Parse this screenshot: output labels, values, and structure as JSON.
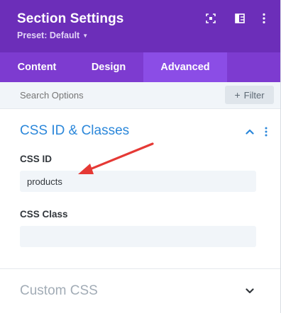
{
  "header": {
    "title": "Section Settings",
    "preset_label": "Preset: Default",
    "icons": [
      "expand-icon",
      "split-view-icon",
      "more-vertical-icon"
    ]
  },
  "tabs": [
    {
      "label": "Content",
      "active": false
    },
    {
      "label": "Design",
      "active": false
    },
    {
      "label": "Advanced",
      "active": true
    }
  ],
  "search": {
    "placeholder": "Search Options",
    "filter_label": "Filter"
  },
  "sections": [
    {
      "title": "CSS ID & Classes",
      "expanded": true,
      "fields": [
        {
          "label": "CSS ID",
          "value": "products"
        },
        {
          "label": "CSS Class",
          "value": ""
        }
      ]
    },
    {
      "title": "Custom CSS",
      "expanded": false
    }
  ],
  "colors": {
    "header_bg": "#6c2eb9",
    "tabs_bg": "#7d3bd0",
    "active_tab_bg": "#8b4de6",
    "section_title": "#2b87da",
    "annotation_arrow": "#e53935"
  }
}
